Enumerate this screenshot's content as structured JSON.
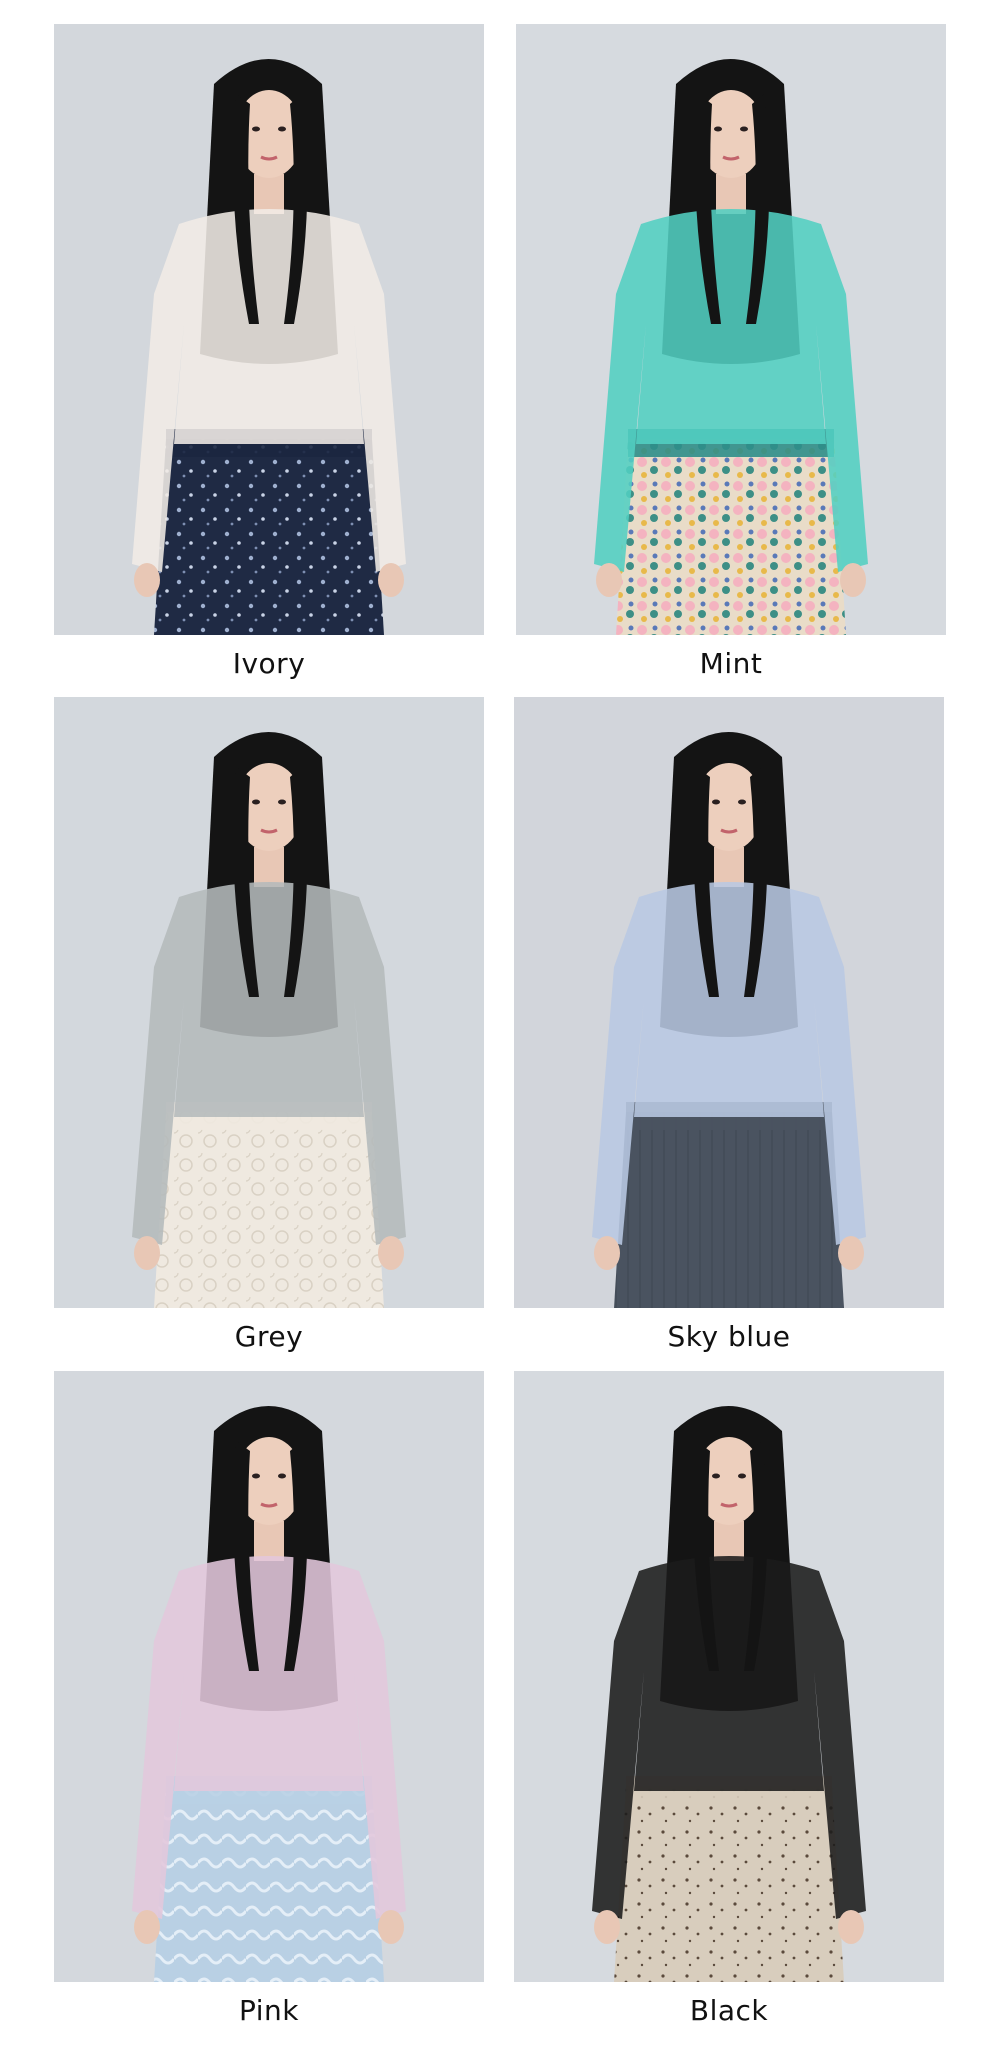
{
  "products": [
    {
      "label": "Ivory",
      "top_color": "#f1ece6",
      "bottom_color": "#1f2a44",
      "bottom_pattern": "floral-dark",
      "band_color": "#1b2640",
      "backdrop": "#d3d7dc"
    },
    {
      "label": "Mint",
      "top_color": "#52cfc2",
      "bottom_color": "#e9dcc8",
      "bottom_pattern": "floral-bright",
      "band_color": "#2f8e8a",
      "backdrop": "#d6dadf"
    },
    {
      "label": "Grey",
      "top_color": "#b4b9bb",
      "bottom_color": "#efe9e0",
      "bottom_pattern": "lace",
      "band_color": "#efe9e0",
      "backdrop": "#d3d8dd"
    },
    {
      "label": "Sky blue",
      "top_color": "#b8c8e2",
      "bottom_color": "#4a5360",
      "bottom_pattern": "plain",
      "band_color": "#4a5360",
      "backdrop": "#d2d5db"
    },
    {
      "label": "Pink",
      "top_color": "#e2c7dc",
      "bottom_color": "#b9d0e4",
      "bottom_pattern": "satin",
      "band_color": "#b9d0e4",
      "backdrop": "#d4d8dd"
    },
    {
      "label": "Black",
      "top_color": "#1b1b1b",
      "bottom_color": "#d8cdbd",
      "bottom_pattern": "dots",
      "band_color": "#d8cdbd",
      "backdrop": "#d6dadf"
    }
  ]
}
